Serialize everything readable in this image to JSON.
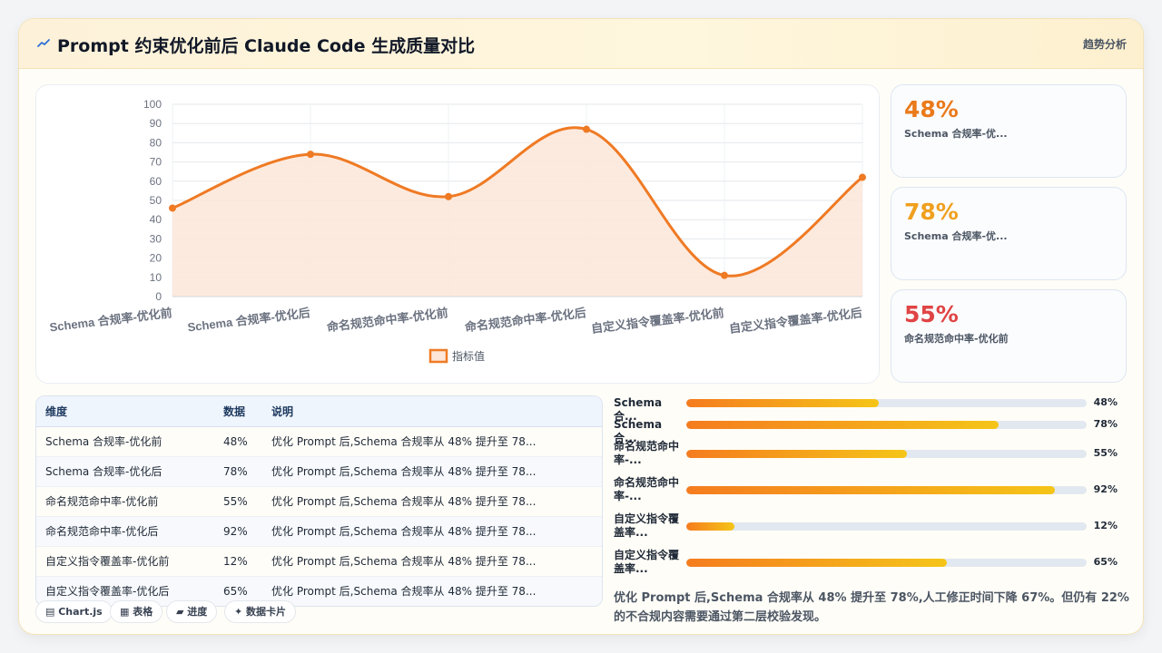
{
  "header": {
    "title": "Prompt 约束优化前后 Claude Code 生成质量对比",
    "tag": "趋势分析",
    "logo_icon": "trend-line-icon"
  },
  "chart_data": {
    "type": "area",
    "categories": [
      "Schema 合规率-优化前",
      "Schema 合规率-优化后",
      "命名规范命中率-优化前",
      "命名规范命中率-优化后",
      "自定义指令覆盖率-优化前",
      "自定义指令覆盖率-优化后"
    ],
    "series": [
      {
        "name": "指标值",
        "values": [
          46,
          74,
          52,
          87,
          11,
          62
        ]
      }
    ],
    "ylim": [
      0,
      100
    ],
    "yticks": [
      0,
      10,
      20,
      30,
      40,
      50,
      60,
      70,
      80,
      90,
      100
    ],
    "grid": true,
    "legend_position": "bottom",
    "line_color": "#ef7a24",
    "fill_color": "#fde6d8"
  },
  "kpis": [
    {
      "value": "48%",
      "label": "Schema 合规率-优...",
      "color": "#ea7a1a"
    },
    {
      "value": "78%",
      "label": "Schema 合规率-优...",
      "color": "#f0a01e"
    },
    {
      "value": "55%",
      "label": "命名规范命中率-优化前",
      "color": "#e04444"
    }
  ],
  "table": {
    "headers": [
      "维度",
      "数据",
      "说明"
    ],
    "rows": [
      [
        "Schema 合规率-优化前",
        "48%",
        "优化 Prompt 后,Schema 合规率从 48% 提升至 78..."
      ],
      [
        "Schema 合规率-优化后",
        "78%",
        "优化 Prompt 后,Schema 合规率从 48% 提升至 78..."
      ],
      [
        "命名规范命中率-优化前",
        "55%",
        "优化 Prompt 后,Schema 合规率从 48% 提升至 78..."
      ],
      [
        "命名规范命中率-优化后",
        "92%",
        "优化 Prompt 后,Schema 合规率从 48% 提升至 78..."
      ],
      [
        "自定义指令覆盖率-优化前",
        "12%",
        "优化 Prompt 后,Schema 合规率从 48% 提升至 78..."
      ],
      [
        "自定义指令覆盖率-优化后",
        "65%",
        "优化 Prompt 后,Schema 合规率从 48% 提升至 78..."
      ]
    ]
  },
  "chips": [
    {
      "label": "▤ Chart.js"
    },
    {
      "label": "▦ 表格"
    },
    {
      "label": "▰ 进度"
    },
    {
      "label": "✦ 数据卡片"
    }
  ],
  "progress": [
    {
      "label": "Schema 合...",
      "value": 0.48,
      "pct": "48%"
    },
    {
      "label": "Schema 合...",
      "value": 0.78,
      "pct": "78%"
    },
    {
      "label": "命名规范命中率-...",
      "value": 0.55,
      "pct": "55%"
    },
    {
      "label": "命名规范命中率-...",
      "value": 0.92,
      "pct": "92%"
    },
    {
      "label": "自定义指令覆盖率...",
      "value": 0.12,
      "pct": "12%"
    },
    {
      "label": "自定义指令覆盖率...",
      "value": 0.65,
      "pct": "65%"
    }
  ],
  "summary": "优化 Prompt 后,Schema 合规率从 48% 提升至 78%,人工修正时间下降 67%。但仍有 22% 的不合规内容需要通过第二层校验发现。"
}
